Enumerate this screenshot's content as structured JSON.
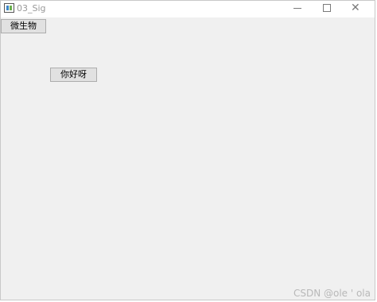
{
  "window": {
    "title": "03_Sig",
    "minimize_glyph": "",
    "maximize_glyph": "",
    "close_glyph": "✕"
  },
  "buttons": {
    "microbe_label": "微生物",
    "hello_label": "你好呀"
  },
  "watermark": {
    "text": "CSDN @ole ' ola"
  },
  "icons": {
    "app": "qt-window-icon",
    "minimize": "minimize-icon",
    "maximize": "maximize-icon",
    "close": "close-icon"
  }
}
